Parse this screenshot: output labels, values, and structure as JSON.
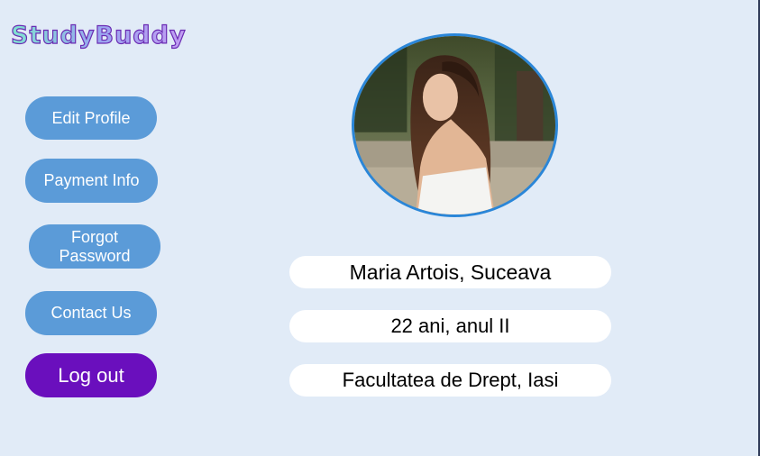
{
  "app": {
    "logo_text": "StudyBuddy"
  },
  "sidebar": {
    "edit_profile": "Edit Profile",
    "payment_info": "Payment Info",
    "forgot_password_line1": "Forgot",
    "forgot_password_line2": "Password",
    "contact_us": "Contact Us",
    "log_out": "Log out"
  },
  "profile": {
    "name_city": "Maria Artois, Suceava",
    "age_year": "22 ani, anul II",
    "faculty": "Facultatea de Drept, Iasi"
  },
  "colors": {
    "background": "#e1ebf7",
    "button_blue": "#5b9bd8",
    "button_logout": "#6a0fbd",
    "avatar_border": "#2a86d8"
  }
}
